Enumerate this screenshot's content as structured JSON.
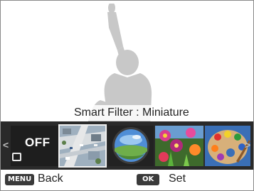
{
  "filter_label": "Smart Filter : Miniature",
  "filters": [
    {
      "id": "off",
      "label": "OFF",
      "selected": false
    },
    {
      "id": "miniature",
      "label": "",
      "selected": true
    },
    {
      "id": "fisheye",
      "label": "",
      "selected": false
    },
    {
      "id": "painting",
      "label": "",
      "selected": false
    },
    {
      "id": "palette",
      "label": "",
      "selected": false
    }
  ],
  "bottom_bar": {
    "menu_key": "MENU",
    "back_label": "Back",
    "ok_key": "OK",
    "set_label": "Set"
  },
  "icons": {
    "left_arrow": "chevron-left-icon",
    "right_arrow": "chevron-right-icon",
    "miniature": "miniature-frame-icon"
  },
  "colors": {
    "strip_background": "#2a2a2a",
    "keycap": "#3a3a3a",
    "selected_border": "#f0f0f0",
    "silhouette": "#c8c8c8"
  }
}
